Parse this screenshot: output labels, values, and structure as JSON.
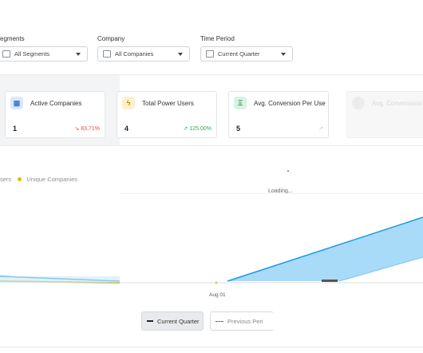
{
  "filters": {
    "segments": {
      "label": "egments",
      "value": "All Segments"
    },
    "company": {
      "label": "Company",
      "value": "All Companies"
    },
    "timeperiod": {
      "label": "Time Period",
      "value": "Current Quarter"
    }
  },
  "cards": [
    {
      "title": "Active Companies",
      "value": "1",
      "trend": "83.71%",
      "trend_dir": "down",
      "icon": "building-icon",
      "color": "#3b7dd8"
    },
    {
      "title": "Total Power Users",
      "value": "4",
      "trend": "125.00%",
      "trend_dir": "up",
      "icon": "bolt-icon",
      "color": "#f0b400"
    },
    {
      "title": "Avg. Conversion Per User",
      "value": "5",
      "trend": "",
      "trend_dir": "up",
      "icon": "chart-icon",
      "color": "#27ae60"
    },
    {
      "title": "Avg. Conversions Per",
      "value": "",
      "trend": "",
      "trend_dir": "",
      "icon": "dot-icon",
      "color": "#e2e2e2"
    }
  ],
  "legend": {
    "series_a": "sers",
    "series_b": "Unique Companies"
  },
  "loading_text": "Loading...",
  "x_tick": "Aug 01",
  "buttons": {
    "current": "Current Quarter",
    "previous": "Previous Peri"
  },
  "colors": {
    "line": "#1e9ae0",
    "fill": "#a8dbf7",
    "accent": "#f0b400",
    "down": "#e74c3c",
    "up": "#27ae60"
  },
  "chart_data": {
    "type": "area",
    "x": [
      "Aug 01"
    ],
    "series": [
      {
        "name": "Unique Companies",
        "values": [
          0
        ]
      }
    ]
  }
}
